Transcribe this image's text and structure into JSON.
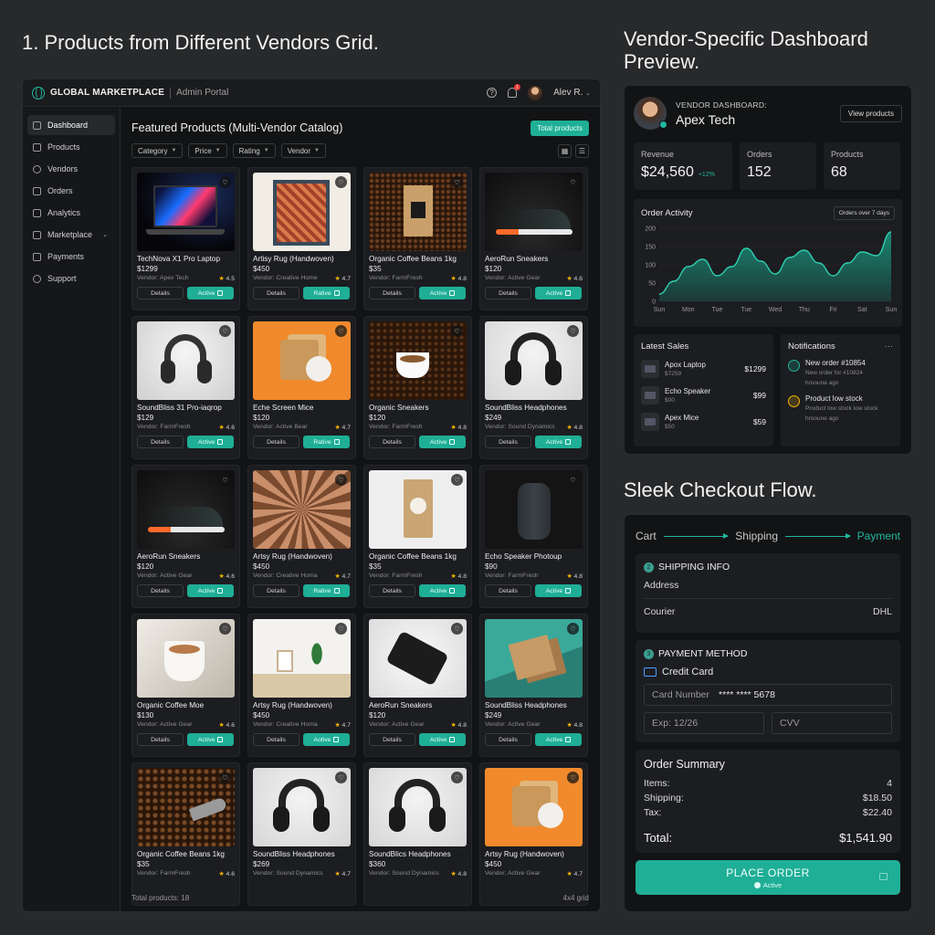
{
  "sections": {
    "grid_title": "1. Products from Different Vendors Grid.",
    "dashboard_title": "Vendor-Specific Dashboard Preview.",
    "checkout_title": "Sleek Checkout Flow."
  },
  "admin": {
    "brand": "GLOBAL MARKETPLACE",
    "portal": "Admin Portal",
    "help_icon": "?",
    "notif_count": "1",
    "user_name": "Alev R.",
    "sidebar": [
      {
        "label": "Dashboard",
        "icon": "grid-icon"
      },
      {
        "label": "Products",
        "icon": "box-icon"
      },
      {
        "label": "Vendors",
        "icon": "users-icon"
      },
      {
        "label": "Orders",
        "icon": "clipboard-icon"
      },
      {
        "label": "Analytics",
        "icon": "chart-icon"
      },
      {
        "label": "Marketplace",
        "icon": "store-icon"
      },
      {
        "label": "Payments",
        "icon": "card-icon"
      },
      {
        "label": "Support",
        "icon": "help-icon"
      }
    ],
    "main_title": "Featured Products (Multi-Vendor Catalog)",
    "total_button": "Total products",
    "filters": [
      "Category",
      "Price",
      "Rating",
      "Vendor"
    ],
    "details_label": "Details",
    "footer_left": "Total products: 18",
    "footer_right": "4x4 grid",
    "products": [
      {
        "name": "TechNova X1 Pro Laptop",
        "price": "$1299",
        "vendor": "Vendor: Apex Tech",
        "rating": "4.5",
        "status": "Active"
      },
      {
        "name": "Artisy Rug (Handwoven)",
        "price": "$450",
        "vendor": "Vendor: Creative Home",
        "rating": "4.7",
        "status": "Rative"
      },
      {
        "name": "Organic Coffee Beans 1kg",
        "price": "$35",
        "vendor": "Vendor: FarmFresh",
        "rating": "4.8",
        "status": "Active"
      },
      {
        "name": "AeroRun Sneakers",
        "price": "$120",
        "vendor": "Vendor: Active Gear",
        "rating": "4.6",
        "status": "Active"
      },
      {
        "name": "SoundBliss 31 Pro-iaqrop",
        "price": "$129",
        "vendor": "Vendor: FarmFresh",
        "rating": "4.6",
        "status": "Active"
      },
      {
        "name": "Eche Screen Mice",
        "price": "$120",
        "vendor": "Vendor: Active Bear",
        "rating": "4.7",
        "status": "Rative"
      },
      {
        "name": "Organic Sneakers",
        "price": "$120",
        "vendor": "Vendor: FarmFresh",
        "rating": "4.8",
        "status": "Active"
      },
      {
        "name": "SoundBliss Headphones",
        "price": "$249",
        "vendor": "Vendor: Sound Dynamics",
        "rating": "4.8",
        "status": "Active"
      },
      {
        "name": "AeroRun Sneakers",
        "price": "$120",
        "vendor": "Vendor: Active Gear",
        "rating": "4.6",
        "status": "Active"
      },
      {
        "name": "Artsy Rug (Handwoven)",
        "price": "$450",
        "vendor": "Vendor: Creative Homa",
        "rating": "4.7",
        "status": "Rative"
      },
      {
        "name": "Organic Coffee Beans 1kg",
        "price": "$35",
        "vendor": "Vendor: FarmFresh",
        "rating": "4.8",
        "status": "Active"
      },
      {
        "name": "Echo Speaker Photoup",
        "price": "$90",
        "vendor": "Vendor: FarmFresh",
        "rating": "4.8",
        "status": "Active"
      },
      {
        "name": "Organic Coffee Moe",
        "price": "$130",
        "vendor": "Vendor: Active Gear",
        "rating": "4.6",
        "status": "Active"
      },
      {
        "name": "Artsy Rug (Handwoven)",
        "price": "$450",
        "vendor": "Vendor: Creative Homa",
        "rating": "4.7",
        "status": "Aotive"
      },
      {
        "name": "AeroRun Sneakers",
        "price": "$120",
        "vendor": "Vendor: Active Gear",
        "rating": "4.8",
        "status": "Active"
      },
      {
        "name": "SoundBliss Headphones",
        "price": "$249",
        "vendor": "Vendor: Active Gear",
        "rating": "4.8",
        "status": "Active"
      },
      {
        "name": "Organic Coffee Beans 1kg",
        "price": "$35",
        "vendor": "Vendor: FarmFresh",
        "rating": "4.6",
        "status": ""
      },
      {
        "name": "SoundBliss Headphones",
        "price": "$269",
        "vendor": "Vendor: Sound Dynamics",
        "rating": "4.7",
        "status": ""
      },
      {
        "name": "SoundBlics Headphones",
        "price": "$360",
        "vendor": "Vendor: Sound Dynamics",
        "rating": "4.8",
        "status": ""
      },
      {
        "name": "Artsy Rug (Handwoven)",
        "price": "$450",
        "vendor": "Vendor: Active Gear",
        "rating": "4.7",
        "status": ""
      }
    ]
  },
  "vendor": {
    "label": "VENDOR DASHBOARD:",
    "name": "Apex Tech",
    "view_button": "View products",
    "stats": [
      {
        "label": "Revenue",
        "value": "$24,560",
        "delta": "+12%"
      },
      {
        "label": "Orders",
        "value": "152",
        "delta": ""
      },
      {
        "label": "Products",
        "value": "68",
        "delta": ""
      }
    ],
    "order_activity": {
      "title": "Order Activity",
      "tag": "Orders over 7 days"
    },
    "latest_sales": {
      "title": "Latest Sales",
      "items": [
        {
          "name": "Apox Laptop",
          "sub": "$7259",
          "price": "$1299"
        },
        {
          "name": "Echo Speaker",
          "sub": "$00",
          "price": "$99"
        },
        {
          "name": "Apex Mice",
          "sub": "$50",
          "price": "$59"
        }
      ]
    },
    "notifications": {
      "title": "Notifications",
      "more": "···",
      "items": [
        {
          "title": "New order #10854",
          "desc": "New order for #10824",
          "time": "hrooune ago",
          "color": "#1fb89e"
        },
        {
          "title": "Product low stock",
          "desc": "Product low stock low stock",
          "time": "hrooune ago",
          "color": "#f5b400"
        }
      ]
    }
  },
  "chart_data": {
    "type": "area",
    "title": "Order Activity",
    "categories": [
      "Sun",
      "Mon",
      "Tue",
      "Tue",
      "Wed",
      "Thu",
      "Fri",
      "Sat",
      "Sun"
    ],
    "y_ticks": [
      0,
      50,
      100,
      150,
      200
    ],
    "ylim": [
      0,
      200
    ],
    "x": [
      0,
      0.5,
      1,
      1.5,
      2,
      2.5,
      3,
      3.5,
      4,
      4.5,
      5,
      5.5,
      6,
      6.5,
      7,
      7.5,
      8
    ],
    "series": [
      {
        "values": [
          20,
          55,
          95,
          115,
          70,
          95,
          145,
          110,
          75,
          120,
          140,
          105,
          70,
          105,
          135,
          125,
          190
        ]
      }
    ],
    "grid": true,
    "colors": {
      "line": "#2fd1b1",
      "fill": "#1a8c78"
    }
  },
  "checkout": {
    "steps": [
      "Cart",
      "Shipping",
      "Payment"
    ],
    "shipping": {
      "num": "2",
      "title": "SHIPPING INFO",
      "address_label": "Address",
      "courier_label": "Courier",
      "courier_value": "DHL"
    },
    "payment": {
      "num": "3",
      "title": "PAYMENT METHOD",
      "method": "Credit Card",
      "card_label": "Card Number",
      "card_value": "**** **** 5678",
      "exp": "Exp: 12/26",
      "cvv": "CVV"
    },
    "summary": {
      "title": "Order Summary",
      "items_label": "Items:",
      "items_value": "4",
      "shipping_label": "Shipping:",
      "shipping_value": "$18.50",
      "tax_label": "Tax:",
      "tax_value": "$22.40",
      "total_label": "Total:",
      "total_value": "$1,541.90"
    },
    "place_order": "PLACE ORDER",
    "place_status": "Active"
  },
  "colors": {
    "accent": "#1fae96",
    "background": "#28292b",
    "panel": "#121314",
    "card": "#1c1d20",
    "star": "#f5b400"
  }
}
